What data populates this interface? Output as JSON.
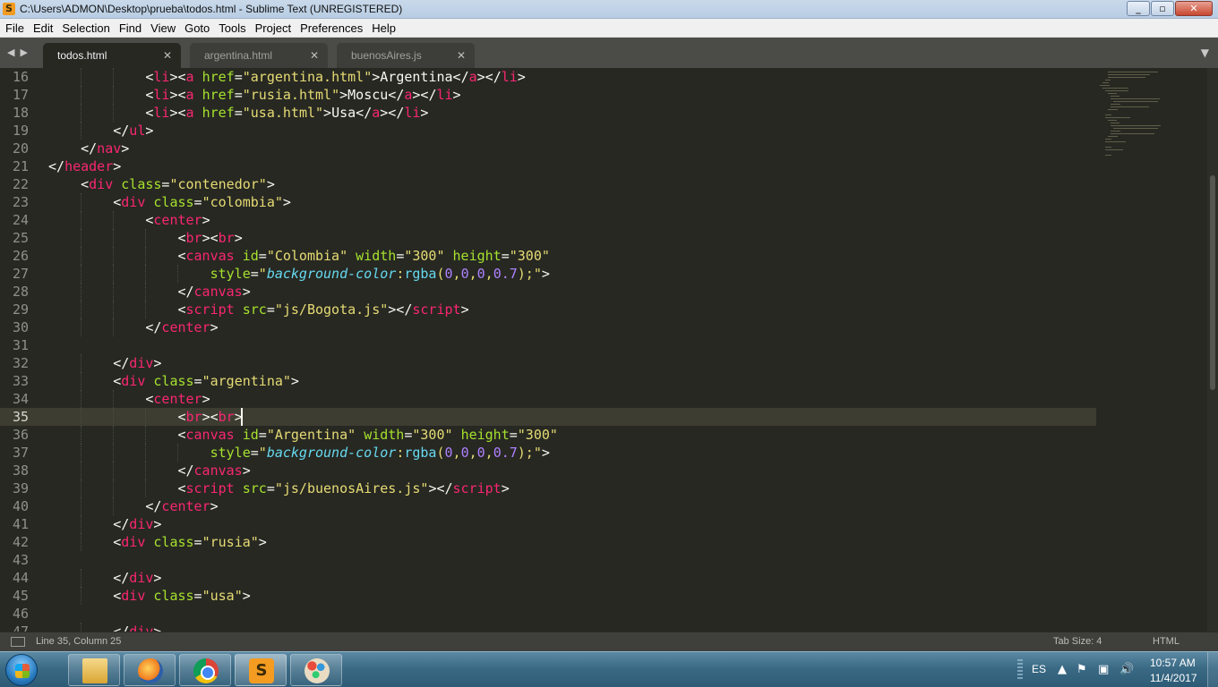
{
  "window": {
    "title": "C:\\Users\\ADMON\\Desktop\\prueba\\todos.html - Sublime Text (UNREGISTERED)",
    "app_icon_glyph": "S"
  },
  "window_buttons": [
    "minimize",
    "maximize",
    "close"
  ],
  "menu": [
    "File",
    "Edit",
    "Selection",
    "Find",
    "View",
    "Goto",
    "Tools",
    "Project",
    "Preferences",
    "Help"
  ],
  "tabs": [
    {
      "label": "todos.html",
      "active": true
    },
    {
      "label": "argentina.html",
      "active": false
    },
    {
      "label": "buenosAires.js",
      "active": false
    }
  ],
  "tab_close_glyph": "✕",
  "editor": {
    "first_line": 16,
    "current_line": 35,
    "cursor_column": 25,
    "lines": [
      {
        "n": 16,
        "indent": 3,
        "tokens": [
          [
            "t",
            "<"
          ],
          [
            "g",
            "li"
          ],
          [
            "t",
            ">"
          ],
          [
            "t",
            "<"
          ],
          [
            "g",
            "a"
          ],
          [
            "t",
            " "
          ],
          [
            "a",
            "href"
          ],
          [
            "t",
            "="
          ],
          [
            "s",
            "\"argentina.html\""
          ],
          [
            "t",
            ">Argentina</"
          ],
          [
            "g",
            "a"
          ],
          [
            "t",
            "></"
          ],
          [
            "g",
            "li"
          ],
          [
            "t",
            ">"
          ]
        ]
      },
      {
        "n": 17,
        "indent": 3,
        "tokens": [
          [
            "t",
            "<"
          ],
          [
            "g",
            "li"
          ],
          [
            "t",
            ">"
          ],
          [
            "t",
            "<"
          ],
          [
            "g",
            "a"
          ],
          [
            "t",
            " "
          ],
          [
            "a",
            "href"
          ],
          [
            "t",
            "="
          ],
          [
            "s",
            "\"rusia.html\""
          ],
          [
            "t",
            ">Moscu</"
          ],
          [
            "g",
            "a"
          ],
          [
            "t",
            "></"
          ],
          [
            "g",
            "li"
          ],
          [
            "t",
            ">"
          ]
        ]
      },
      {
        "n": 18,
        "indent": 3,
        "tokens": [
          [
            "t",
            "<"
          ],
          [
            "g",
            "li"
          ],
          [
            "t",
            ">"
          ],
          [
            "t",
            "<"
          ],
          [
            "g",
            "a"
          ],
          [
            "t",
            " "
          ],
          [
            "a",
            "href"
          ],
          [
            "t",
            "="
          ],
          [
            "s",
            "\"usa.html\""
          ],
          [
            "t",
            ">Usa</"
          ],
          [
            "g",
            "a"
          ],
          [
            "t",
            "></"
          ],
          [
            "g",
            "li"
          ],
          [
            "t",
            ">"
          ]
        ]
      },
      {
        "n": 19,
        "indent": 2,
        "tokens": [
          [
            "t",
            "</"
          ],
          [
            "g",
            "ul"
          ],
          [
            "t",
            ">"
          ]
        ]
      },
      {
        "n": 20,
        "indent": 1,
        "tokens": [
          [
            "t",
            "</"
          ],
          [
            "g",
            "nav"
          ],
          [
            "t",
            ">"
          ]
        ]
      },
      {
        "n": 21,
        "indent": 0,
        "tokens": [
          [
            "t",
            "</"
          ],
          [
            "g",
            "header"
          ],
          [
            "t",
            ">"
          ]
        ]
      },
      {
        "n": 22,
        "indent": 1,
        "tokens": [
          [
            "t",
            "<"
          ],
          [
            "g",
            "div"
          ],
          [
            "t",
            " "
          ],
          [
            "a",
            "class"
          ],
          [
            "t",
            "="
          ],
          [
            "s",
            "\"contenedor\""
          ],
          [
            "t",
            ">"
          ]
        ]
      },
      {
        "n": 23,
        "indent": 2,
        "tokens": [
          [
            "t",
            "<"
          ],
          [
            "g",
            "div"
          ],
          [
            "t",
            " "
          ],
          [
            "a",
            "class"
          ],
          [
            "t",
            "="
          ],
          [
            "s",
            "\"colombia\""
          ],
          [
            "t",
            ">"
          ]
        ]
      },
      {
        "n": 24,
        "indent": 3,
        "tokens": [
          [
            "t",
            "<"
          ],
          [
            "g",
            "center"
          ],
          [
            "t",
            ">"
          ]
        ]
      },
      {
        "n": 25,
        "indent": 4,
        "tokens": [
          [
            "t",
            "<"
          ],
          [
            "g",
            "br"
          ],
          [
            "t",
            "><"
          ],
          [
            "g",
            "br"
          ],
          [
            "t",
            ">"
          ]
        ]
      },
      {
        "n": 26,
        "indent": 4,
        "tokens": [
          [
            "t",
            "<"
          ],
          [
            "g",
            "canvas"
          ],
          [
            "t",
            " "
          ],
          [
            "a",
            "id"
          ],
          [
            "t",
            "="
          ],
          [
            "s",
            "\"Colombia\""
          ],
          [
            "t",
            " "
          ],
          [
            "a",
            "width"
          ],
          [
            "t",
            "="
          ],
          [
            "s",
            "\"300\""
          ],
          [
            "t",
            " "
          ],
          [
            "a",
            "height"
          ],
          [
            "t",
            "="
          ],
          [
            "s",
            "\"300\""
          ]
        ]
      },
      {
        "n": 27,
        "indent": 5,
        "tokens": [
          [
            "a",
            "style"
          ],
          [
            "t",
            "="
          ],
          [
            "s",
            "\""
          ],
          [
            "p",
            "background-color"
          ],
          [
            "s",
            ":"
          ],
          [
            "f",
            "rgba"
          ],
          [
            "s",
            "("
          ],
          [
            "m",
            "0"
          ],
          [
            "s",
            ","
          ],
          [
            "m",
            "0"
          ],
          [
            "s",
            ","
          ],
          [
            "m",
            "0"
          ],
          [
            "s",
            ","
          ],
          [
            "m",
            "0.7"
          ],
          [
            "s",
            ");\""
          ],
          [
            "t",
            ">"
          ]
        ]
      },
      {
        "n": 28,
        "indent": 4,
        "tokens": [
          [
            "t",
            "</"
          ],
          [
            "g",
            "canvas"
          ],
          [
            "t",
            ">"
          ]
        ]
      },
      {
        "n": 29,
        "indent": 4,
        "tokens": [
          [
            "t",
            "<"
          ],
          [
            "g",
            "script"
          ],
          [
            "t",
            " "
          ],
          [
            "a",
            "src"
          ],
          [
            "t",
            "="
          ],
          [
            "s",
            "\"js/Bogota.js\""
          ],
          [
            "t",
            "></"
          ],
          [
            "g",
            "script"
          ],
          [
            "t",
            ">"
          ]
        ]
      },
      {
        "n": 30,
        "indent": 3,
        "tokens": [
          [
            "t",
            "</"
          ],
          [
            "g",
            "center"
          ],
          [
            "t",
            ">"
          ]
        ]
      },
      {
        "n": 31,
        "indent": 0,
        "tokens": []
      },
      {
        "n": 32,
        "indent": 2,
        "tokens": [
          [
            "t",
            "</"
          ],
          [
            "g",
            "div"
          ],
          [
            "t",
            ">"
          ]
        ]
      },
      {
        "n": 33,
        "indent": 2,
        "tokens": [
          [
            "t",
            "<"
          ],
          [
            "g",
            "div"
          ],
          [
            "t",
            " "
          ],
          [
            "a",
            "class"
          ],
          [
            "t",
            "="
          ],
          [
            "s",
            "\"argentina\""
          ],
          [
            "t",
            ">"
          ]
        ]
      },
      {
        "n": 34,
        "indent": 3,
        "tokens": [
          [
            "t",
            "<"
          ],
          [
            "g",
            "center"
          ],
          [
            "t",
            ">"
          ]
        ]
      },
      {
        "n": 35,
        "indent": 4,
        "tokens": [
          [
            "t",
            "<"
          ],
          [
            "g",
            "br"
          ],
          [
            "t",
            "><"
          ],
          [
            "g",
            "br"
          ],
          [
            "t",
            ">"
          ]
        ]
      },
      {
        "n": 36,
        "indent": 4,
        "tokens": [
          [
            "t",
            "<"
          ],
          [
            "g",
            "canvas"
          ],
          [
            "t",
            " "
          ],
          [
            "a",
            "id"
          ],
          [
            "t",
            "="
          ],
          [
            "s",
            "\"Argentina\""
          ],
          [
            "t",
            " "
          ],
          [
            "a",
            "width"
          ],
          [
            "t",
            "="
          ],
          [
            "s",
            "\"300\""
          ],
          [
            "t",
            " "
          ],
          [
            "a",
            "height"
          ],
          [
            "t",
            "="
          ],
          [
            "s",
            "\"300\""
          ]
        ]
      },
      {
        "n": 37,
        "indent": 5,
        "tokens": [
          [
            "a",
            "style"
          ],
          [
            "t",
            "="
          ],
          [
            "s",
            "\""
          ],
          [
            "p",
            "background-color"
          ],
          [
            "s",
            ":"
          ],
          [
            "f",
            "rgba"
          ],
          [
            "s",
            "("
          ],
          [
            "m",
            "0"
          ],
          [
            "s",
            ","
          ],
          [
            "m",
            "0"
          ],
          [
            "s",
            ","
          ],
          [
            "m",
            "0"
          ],
          [
            "s",
            ","
          ],
          [
            "m",
            "0.7"
          ],
          [
            "s",
            ");\""
          ],
          [
            "t",
            ">"
          ]
        ]
      },
      {
        "n": 38,
        "indent": 4,
        "tokens": [
          [
            "t",
            "</"
          ],
          [
            "g",
            "canvas"
          ],
          [
            "t",
            ">"
          ]
        ]
      },
      {
        "n": 39,
        "indent": 4,
        "tokens": [
          [
            "t",
            "<"
          ],
          [
            "g",
            "script"
          ],
          [
            "t",
            " "
          ],
          [
            "a",
            "src"
          ],
          [
            "t",
            "="
          ],
          [
            "s",
            "\"js/buenosAires.js\""
          ],
          [
            "t",
            "></"
          ],
          [
            "g",
            "script"
          ],
          [
            "t",
            ">"
          ]
        ]
      },
      {
        "n": 40,
        "indent": 3,
        "tokens": [
          [
            "t",
            "</"
          ],
          [
            "g",
            "center"
          ],
          [
            "t",
            ">"
          ]
        ]
      },
      {
        "n": 41,
        "indent": 2,
        "tokens": [
          [
            "t",
            "</"
          ],
          [
            "g",
            "div"
          ],
          [
            "t",
            ">"
          ]
        ]
      },
      {
        "n": 42,
        "indent": 2,
        "tokens": [
          [
            "t",
            "<"
          ],
          [
            "g",
            "div"
          ],
          [
            "t",
            " "
          ],
          [
            "a",
            "class"
          ],
          [
            "t",
            "="
          ],
          [
            "s",
            "\"rusia\""
          ],
          [
            "t",
            ">"
          ]
        ]
      },
      {
        "n": 43,
        "indent": 0,
        "tokens": []
      },
      {
        "n": 44,
        "indent": 2,
        "tokens": [
          [
            "t",
            "</"
          ],
          [
            "g",
            "div"
          ],
          [
            "t",
            ">"
          ]
        ]
      },
      {
        "n": 45,
        "indent": 2,
        "tokens": [
          [
            "t",
            "<"
          ],
          [
            "g",
            "div"
          ],
          [
            "t",
            " "
          ],
          [
            "a",
            "class"
          ],
          [
            "t",
            "="
          ],
          [
            "s",
            "\"usa\""
          ],
          [
            "t",
            ">"
          ]
        ]
      },
      {
        "n": 46,
        "indent": 0,
        "tokens": []
      },
      {
        "n": 47,
        "indent": 2,
        "tokens": [
          [
            "t",
            "</"
          ],
          [
            "g",
            "div"
          ],
          [
            "t",
            ">"
          ]
        ]
      }
    ]
  },
  "theme": {
    "background": "#272822",
    "tag": "#f92672",
    "attribute": "#a6e22e",
    "string": "#e6db74",
    "number": "#ae81ff",
    "property": "#66d9ef",
    "text": "#f8f8f2"
  },
  "statusbar": {
    "position": "Line 35, Column 25",
    "tab_size": "Tab Size: 4",
    "syntax": "HTML"
  },
  "taskbar": {
    "apps": [
      {
        "name": "Windows Explorer",
        "icon": "folder-icon"
      },
      {
        "name": "Firefox",
        "icon": "firefox-icon"
      },
      {
        "name": "Chrome",
        "icon": "chrome-icon"
      },
      {
        "name": "Sublime Text",
        "icon": "sublime-icon",
        "active": true
      },
      {
        "name": "Paint",
        "icon": "paint-icon"
      }
    ],
    "language": "ES",
    "time": "10:57 AM",
    "date": "11/4/2017"
  }
}
